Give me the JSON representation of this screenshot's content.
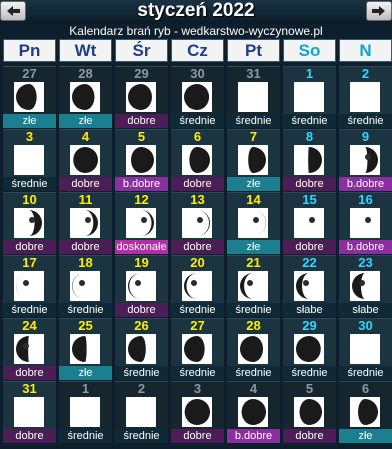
{
  "header": {
    "title": "styczeń 2022",
    "subtitle": "Kalendarz brań ryb - wedkarstwo-wyczynowe.pl"
  },
  "colors": {
    "zle": "#1b7f8f",
    "srednie": "#0f2a36",
    "dobre": "#4c1d57",
    "slabe": "#0f2a36",
    "b_dobre": "#8c2ea0",
    "doskonale": "#b52ea8",
    "number_default": "#ffee00",
    "number_weekend": "#33d6ff",
    "number_outside": "#8a9aa4"
  },
  "day_names": [
    "Pn",
    "Wt",
    "Śr",
    "Cz",
    "Pt",
    "So",
    "N"
  ],
  "weeks": [
    [
      {
        "day": "27",
        "rating": "złe",
        "rtype": "zle",
        "phase": 0.85,
        "out": true
      },
      {
        "day": "28",
        "rating": "złe",
        "rtype": "zle",
        "phase": 0.88,
        "out": true
      },
      {
        "day": "29",
        "rating": "dobre",
        "rtype": "dobre",
        "phase": 0.91,
        "out": true
      },
      {
        "day": "30",
        "rating": "średnie",
        "rtype": "srednie",
        "phase": 0.94,
        "out": true
      },
      {
        "day": "31",
        "rating": "średnie",
        "rtype": "srednie",
        "phase": 0.97,
        "out": true
      },
      {
        "day": "1",
        "rating": "średnie",
        "rtype": "srednie",
        "phase": 0.0,
        "out": false
      },
      {
        "day": "2",
        "rating": "średnie",
        "rtype": "srednie",
        "phase": 0.02,
        "out": false
      }
    ],
    [
      {
        "day": "3",
        "rating": "średnie",
        "rtype": "srednie",
        "phase": 0.04,
        "out": false
      },
      {
        "day": "4",
        "rating": "dobre",
        "rtype": "dobre",
        "phase": 0.07,
        "out": false
      },
      {
        "day": "5",
        "rating": "b.dobre",
        "rtype": "b_dobre",
        "phase": 0.11,
        "out": false
      },
      {
        "day": "6",
        "rating": "dobre",
        "rtype": "dobre",
        "phase": 0.15,
        "out": false
      },
      {
        "day": "7",
        "rating": "złe",
        "rtype": "zle",
        "phase": 0.19,
        "out": false
      },
      {
        "day": "8",
        "rating": "dobre",
        "rtype": "dobre",
        "phase": 0.24,
        "out": false
      },
      {
        "day": "9",
        "rating": "b.dobre",
        "rtype": "b_dobre",
        "phase": 0.28,
        "out": false
      }
    ],
    [
      {
        "day": "10",
        "rating": "dobre",
        "rtype": "dobre",
        "phase": 0.32,
        "out": false
      },
      {
        "day": "11",
        "rating": "dobre",
        "rtype": "dobre",
        "phase": 0.36,
        "out": false
      },
      {
        "day": "12",
        "rating": "doskonałe",
        "rtype": "doskonale",
        "phase": 0.4,
        "out": false
      },
      {
        "day": "13",
        "rating": "dobre",
        "rtype": "dobre",
        "phase": 0.44,
        "out": false
      },
      {
        "day": "14",
        "rating": "złe",
        "rtype": "zle",
        "phase": 0.47,
        "out": false
      },
      {
        "day": "15",
        "rating": "dobre",
        "rtype": "dobre",
        "phase": 0.49,
        "out": false
      },
      {
        "day": "16",
        "rating": "b.dobre",
        "rtype": "b_dobre",
        "phase": 0.5,
        "out": false
      }
    ],
    [
      {
        "day": "17",
        "rating": "średnie",
        "rtype": "srednie",
        "phase": 0.52,
        "out": false
      },
      {
        "day": "18",
        "rating": "średnie",
        "rtype": "srednie",
        "phase": 0.54,
        "out": false
      },
      {
        "day": "19",
        "rating": "dobre",
        "rtype": "dobre",
        "phase": 0.57,
        "out": false
      },
      {
        "day": "20",
        "rating": "średnie",
        "rtype": "srednie",
        "phase": 0.6,
        "out": false
      },
      {
        "day": "21",
        "rating": "średnie",
        "rtype": "srednie",
        "phase": 0.63,
        "out": false
      },
      {
        "day": "22",
        "rating": "słabe",
        "rtype": "slabe",
        "phase": 0.66,
        "out": false
      },
      {
        "day": "23",
        "rating": "słabe",
        "rtype": "slabe",
        "phase": 0.7,
        "out": false
      }
    ],
    [
      {
        "day": "24",
        "rating": "dobre",
        "rtype": "dobre",
        "phase": 0.74,
        "out": false
      },
      {
        "day": "25",
        "rating": "złe",
        "rtype": "zle",
        "phase": 0.77,
        "out": false
      },
      {
        "day": "26",
        "rating": "średnie",
        "rtype": "srednie",
        "phase": 0.81,
        "out": false
      },
      {
        "day": "27",
        "rating": "średnie",
        "rtype": "srednie",
        "phase": 0.85,
        "out": false
      },
      {
        "day": "28",
        "rating": "średnie",
        "rtype": "srednie",
        "phase": 0.89,
        "out": false
      },
      {
        "day": "29",
        "rating": "średnie",
        "rtype": "srednie",
        "phase": 0.93,
        "out": false
      },
      {
        "day": "30",
        "rating": "średnie",
        "rtype": "srednie",
        "phase": 0.96,
        "out": false
      }
    ],
    [
      {
        "day": "31",
        "rating": "dobre",
        "rtype": "dobre",
        "phase": 0.99,
        "out": false
      },
      {
        "day": "1",
        "rating": "średnie",
        "rtype": "srednie",
        "phase": 0.0,
        "out": true
      },
      {
        "day": "2",
        "rating": "średnie",
        "rtype": "srednie",
        "phase": 0.02,
        "out": true
      },
      {
        "day": "3",
        "rating": "dobre",
        "rtype": "dobre",
        "phase": 0.05,
        "out": true
      },
      {
        "day": "4",
        "rating": "b.dobre",
        "rtype": "b_dobre",
        "phase": 0.08,
        "out": true
      },
      {
        "day": "5",
        "rating": "dobre",
        "rtype": "dobre",
        "phase": 0.12,
        "out": true
      },
      {
        "day": "6",
        "rating": "złe",
        "rtype": "zle",
        "phase": 0.16,
        "out": true
      }
    ]
  ],
  "icons": {
    "prev": "arrow-left-icon",
    "next": "arrow-right-icon",
    "moon": "moon-phase-icon"
  }
}
